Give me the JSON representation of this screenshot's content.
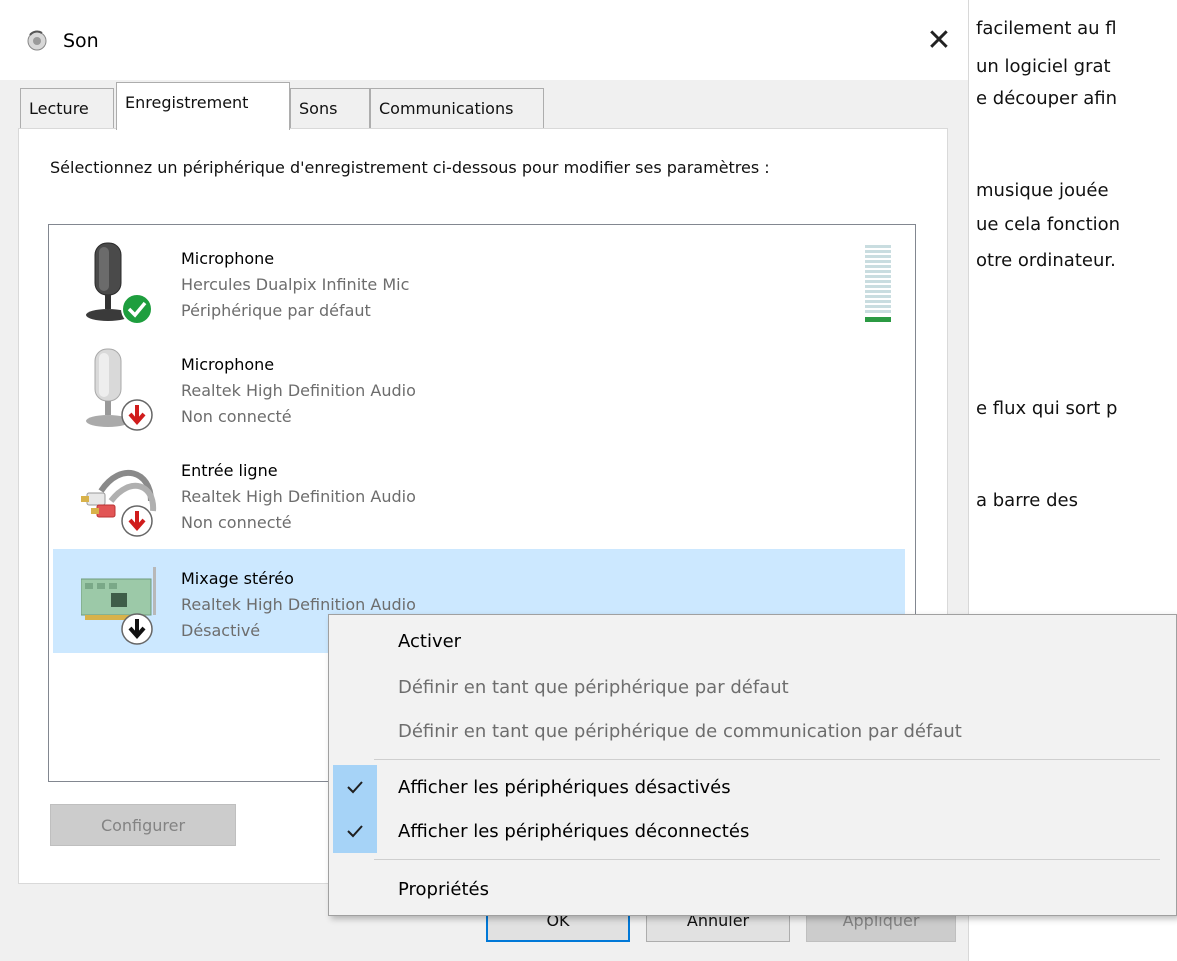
{
  "background_text": [
    "facilement au fl",
    "un logiciel grat",
    "e découper afin",
    "musique jouée",
    "ue cela fonction",
    "otre ordinateur.",
    "e flux qui sort p",
    "a barre des"
  ],
  "dialog": {
    "title": "Son",
    "close_glyph": "✕",
    "tabs": [
      "Lecture",
      "Enregistrement",
      "Sons",
      "Communications"
    ],
    "instructions": "Sélectionnez un périphérique d'enregistrement ci-dessous pour modifier ses paramètres :",
    "devices": [
      {
        "name": "Microphone",
        "driver": "Hercules Dualpix Infinite Mic",
        "status": "Périphérique par défaut",
        "icon": "microphone-default-icon"
      },
      {
        "name": "Microphone",
        "driver": "Realtek High Definition Audio",
        "status": "Non connecté",
        "icon": "microphone-disconnected-icon"
      },
      {
        "name": "Entrée ligne",
        "driver": "Realtek High Definition Audio",
        "status": "Non connecté",
        "icon": "line-in-disconnected-icon"
      },
      {
        "name": "Mixage stéréo",
        "driver": "Realtek High Definition Audio",
        "status": "Désactivé",
        "icon": "sound-card-disabled-icon"
      }
    ],
    "configure_label": "Configurer",
    "ok_label": "OK",
    "cancel_label": "Annuler",
    "apply_label": "Appliquer"
  },
  "context_menu": {
    "items": [
      {
        "label": "Activer",
        "enabled": true,
        "checked": false
      },
      {
        "label": "Définir en tant que périphérique par défaut",
        "enabled": false,
        "checked": false
      },
      {
        "label": "Définir en tant que périphérique de communication par défaut",
        "enabled": false,
        "checked": false
      },
      {
        "label": "Afficher les périphériques désactivés",
        "enabled": true,
        "checked": true
      },
      {
        "label": "Afficher les périphériques déconnectés",
        "enabled": true,
        "checked": true
      },
      {
        "label": "Propriétés",
        "enabled": true,
        "checked": false
      }
    ]
  },
  "colors": {
    "selection": "#cce8ff",
    "check_highlight": "#a6d3f7",
    "ok_border": "#0078d7",
    "meter_green": "#2b9a43"
  }
}
